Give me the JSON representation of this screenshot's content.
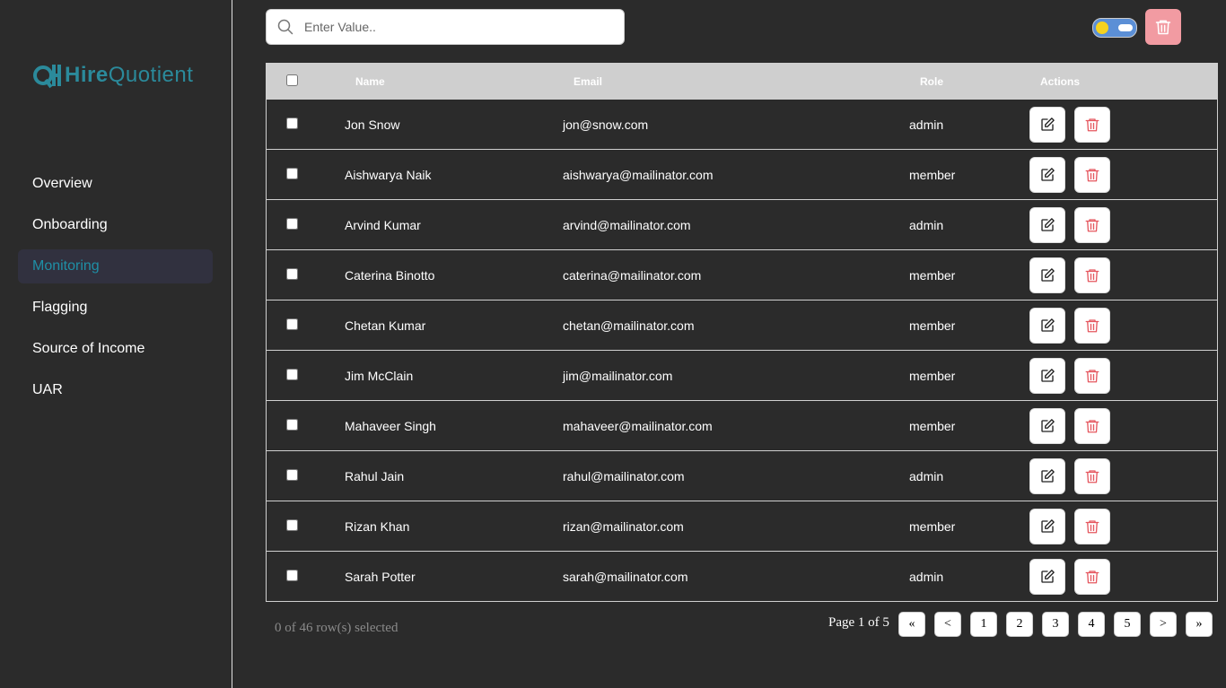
{
  "brand": {
    "part1": "Hire",
    "part2": "Quotient",
    "color": "#2b8a9b"
  },
  "sidebar": {
    "items": [
      {
        "label": "Overview",
        "active": false
      },
      {
        "label": "Onboarding",
        "active": false
      },
      {
        "label": "Monitoring",
        "active": true
      },
      {
        "label": "Flagging",
        "active": false
      },
      {
        "label": "Source of Income",
        "active": false
      },
      {
        "label": "UAR",
        "active": false
      }
    ]
  },
  "search": {
    "placeholder": "Enter Value..",
    "value": ""
  },
  "table": {
    "headers": {
      "name": "Name",
      "email": "Email",
      "role": "Role",
      "actions": "Actions"
    },
    "rows": [
      {
        "name": "Jon Snow",
        "email": "jon@snow.com",
        "role": "admin"
      },
      {
        "name": "Aishwarya Naik",
        "email": "aishwarya@mailinator.com",
        "role": "member"
      },
      {
        "name": "Arvind Kumar",
        "email": "arvind@mailinator.com",
        "role": "admin"
      },
      {
        "name": "Caterina Binotto",
        "email": "caterina@mailinator.com",
        "role": "member"
      },
      {
        "name": "Chetan Kumar",
        "email": "chetan@mailinator.com",
        "role": "member"
      },
      {
        "name": "Jim McClain",
        "email": "jim@mailinator.com",
        "role": "member"
      },
      {
        "name": "Mahaveer Singh",
        "email": "mahaveer@mailinator.com",
        "role": "member"
      },
      {
        "name": "Rahul Jain",
        "email": "rahul@mailinator.com",
        "role": "admin"
      },
      {
        "name": "Rizan Khan",
        "email": "rizan@mailinator.com",
        "role": "member"
      },
      {
        "name": "Sarah Potter",
        "email": "sarah@mailinator.com",
        "role": "admin"
      }
    ]
  },
  "footer": {
    "selected": "0 of 46 row(s) selected",
    "page_info": "Page 1 of 5",
    "buttons": {
      "first": "«",
      "prev": "<",
      "pages": [
        "1",
        "2",
        "3",
        "4",
        "5"
      ],
      "next": ">",
      "last": "»"
    }
  },
  "colors": {
    "background": "#2b2b2b",
    "active_nav": "#1f8fa6",
    "danger": "#e5575f",
    "bulk_delete_bg": "#f29ba2",
    "header_bg": "#cfcfcf"
  }
}
